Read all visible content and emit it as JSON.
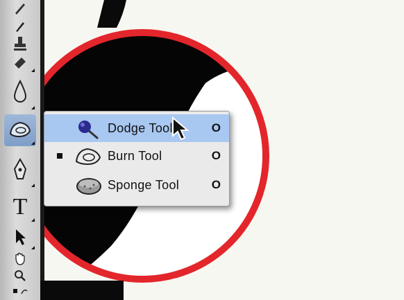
{
  "flyout": {
    "items": [
      {
        "label": "Dodge Tool",
        "shortcut": "O",
        "icon": "dodge-icon",
        "highlighted": true,
        "current": false
      },
      {
        "label": "Burn Tool",
        "shortcut": "O",
        "icon": "burn-icon",
        "highlighted": false,
        "current": true
      },
      {
        "label": "Sponge Tool",
        "shortcut": "O",
        "icon": "sponge-icon",
        "highlighted": false,
        "current": false
      }
    ]
  },
  "toolbar": {
    "type_tool_letter": "T",
    "tools": [
      "brush-icon",
      "clone-stamp-icon",
      "history-brush-icon",
      "blur-icon",
      "dodge-burn-icon",
      "pen-icon",
      "type-icon",
      "path-selection-icon",
      "hand-icon",
      "zoom-icon"
    ]
  },
  "colors": {
    "highlight": "#a8c7f1",
    "ring": "#e3262b",
    "menu_bg": "#eaeaea"
  }
}
